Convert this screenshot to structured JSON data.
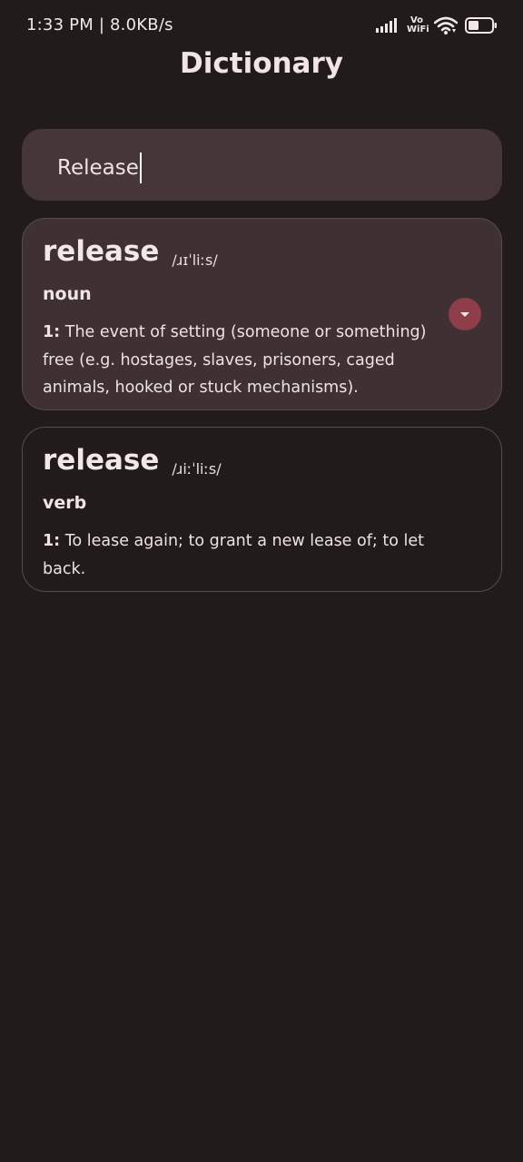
{
  "status_bar": {
    "time_speed": "1:33 PM | 8.0KB/s",
    "vowifi_line1": "Vo",
    "vowifi_line2": "WiFi",
    "icons": [
      "signal-icon",
      "wifi-icon",
      "battery-icon"
    ]
  },
  "app": {
    "title": "Dictionary"
  },
  "search": {
    "value": "Release"
  },
  "results": [
    {
      "word": "release",
      "phonetic": "/ɹɪˈliːs/",
      "part_of_speech": "noun",
      "definition_number": "1:",
      "definition": "The event of setting (someone or something) free (e.g. hostages, slaves, prisoners, caged animals, hooked or stuck mechanisms).",
      "expand_icon": "chevron-down-icon"
    },
    {
      "word": "release",
      "phonetic": "/ɹiːˈliːs/",
      "part_of_speech": "verb",
      "definition_number": "1:",
      "definition": "To lease again; to grant a new lease of; to let back."
    }
  ],
  "colors": {
    "background": "#211b1c",
    "surface": "#473638",
    "card_expanded": "#3f3133",
    "card_border": "#5b4a4c",
    "accent": "#8f3d49",
    "text": "#efe3e3"
  }
}
